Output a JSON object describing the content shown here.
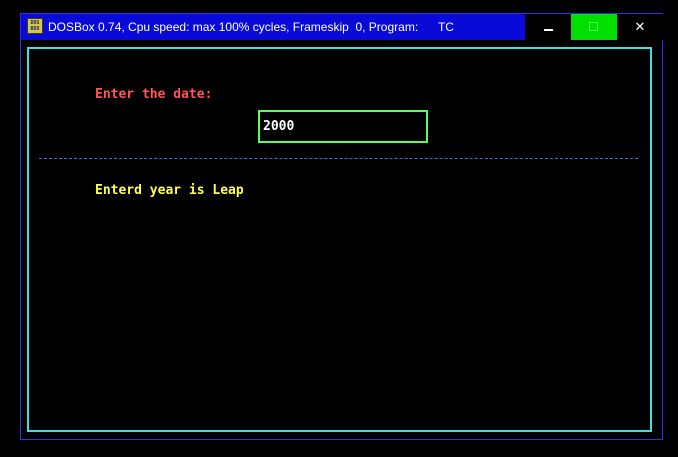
{
  "window": {
    "title": "DOSBox 0.74, Cpu speed: max 100% cycles, Frameskip  0, Program:      TC",
    "icon_label": "DOS BOX",
    "controls": {
      "minimize": "minimize-icon",
      "maximize": "maximize-icon",
      "close_label": "✕"
    },
    "colors": {
      "titlebar": "#0a0ad8",
      "maximize_hover": "#00e000"
    }
  },
  "screen": {
    "prompt_label": "Enter the date:",
    "date_input_value": "2000",
    "result_text": "Enterd year is Leap",
    "colors": {
      "frame": "#40e0e0",
      "prompt": "#ff5555",
      "input_border": "#55ff55",
      "divider": "#3a6ef0",
      "result": "#ffff55"
    }
  }
}
